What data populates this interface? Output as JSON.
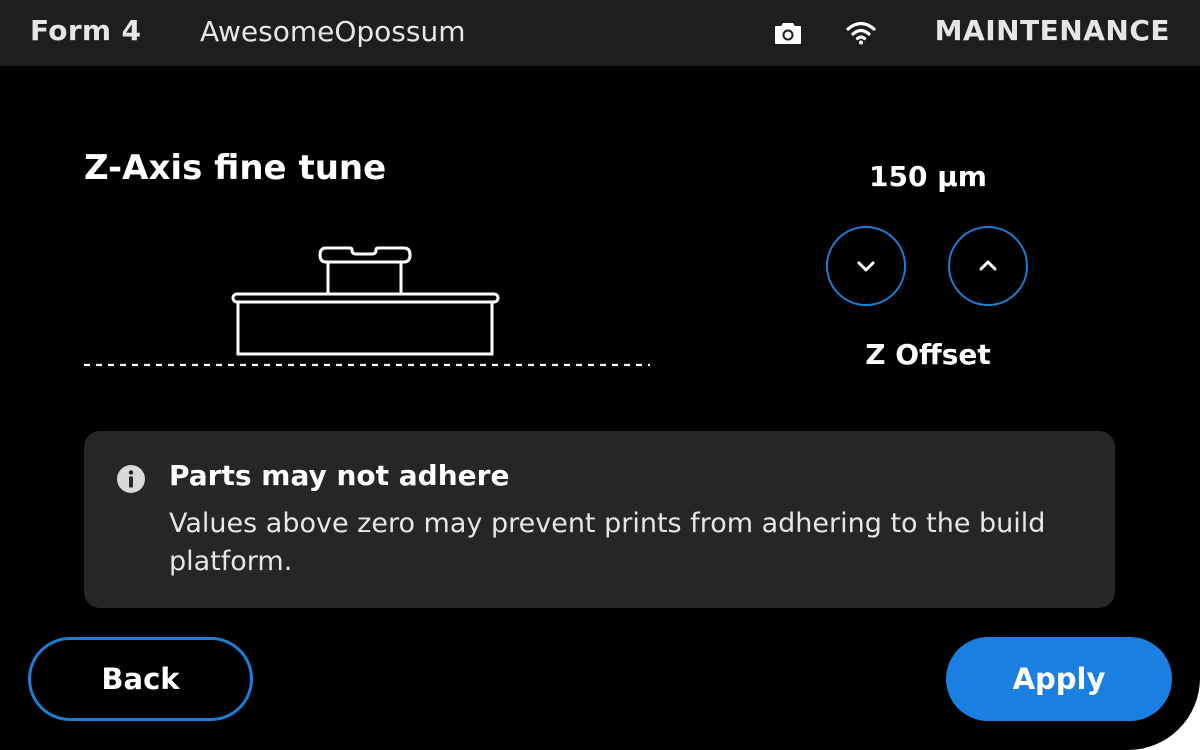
{
  "topbar": {
    "device_name": "Form 4",
    "printer_name": "AwesomeOpossum",
    "camera_icon": "camera-icon",
    "wifi_icon": "wifi-icon",
    "mode": "MAINTENANCE"
  },
  "main": {
    "title": "Z-Axis fine tune",
    "illustration": "build-platform-icon",
    "offset_value": "150 µm",
    "offset_label": "Z Offset",
    "decrease_icon": "chevron-down-icon",
    "increase_icon": "chevron-up-icon"
  },
  "notice": {
    "icon": "info-icon",
    "title": "Parts may not adhere",
    "body": "Values above zero may prevent prints from adhering to the build platform."
  },
  "footer": {
    "back_label": "Back",
    "apply_label": "Apply"
  },
  "colors": {
    "background": "#000000",
    "topbar": "#1e1e1e",
    "card": "#262626",
    "accent": "#1a7fe0",
    "outline": "#1c7ed6"
  }
}
